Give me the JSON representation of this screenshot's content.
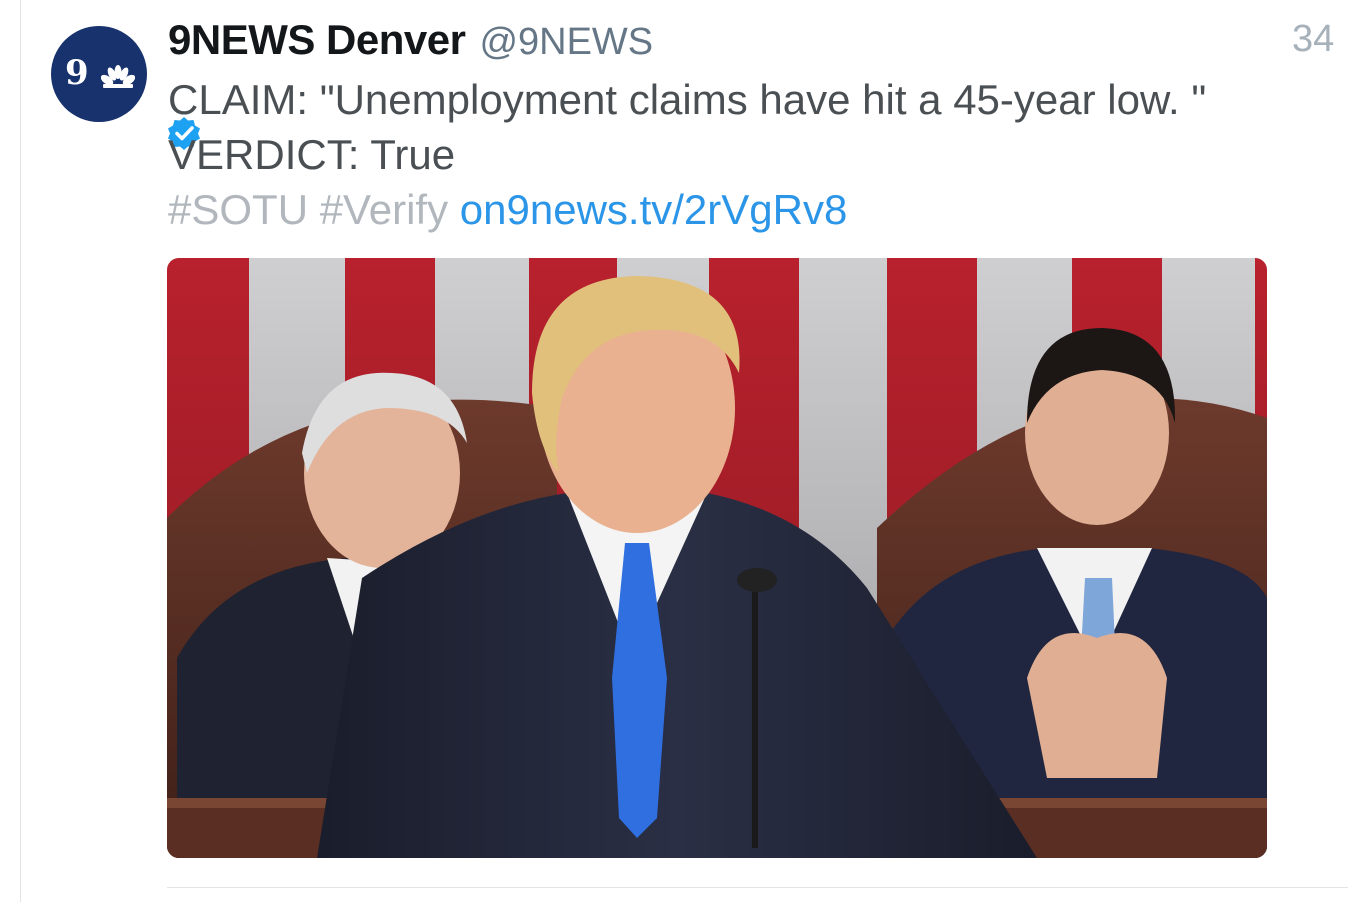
{
  "tweet": {
    "display_name": "9NEWS Denver",
    "handle": "@9NEWS",
    "timestamp": "34",
    "avatar_text": "9",
    "verified": true,
    "text_line1": "CLAIM: \"Unemployment claims have hit a 45-year low. \"",
    "text_line2": "VERDICT: True",
    "hashtag1": "#SOTU",
    "hashtag2": "#Verify",
    "link": "on9news.tv/2rVgRv8"
  },
  "colors": {
    "avatar_bg": "#18326e",
    "verified_blue": "#1da1f2",
    "link_blue": "#2b95e8",
    "hashtag_gray": "#b1b7bd",
    "name_black": "#14171a"
  },
  "icons": {
    "avatar": "9news-logo-icon",
    "badge": "verified-badge-icon"
  }
}
